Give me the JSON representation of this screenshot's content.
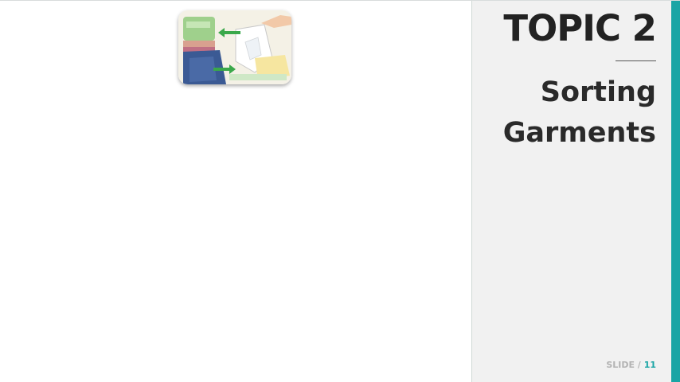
{
  "thumbnail": {
    "image_name": "sorting-garments-illustration"
  },
  "panel": {
    "title": "TOPIC 2",
    "subtitle_lines": [
      "Sorting",
      "Garments"
    ]
  },
  "footer": {
    "slide_label": "SLIDE /",
    "slide_number": "11"
  },
  "colors": {
    "accent": "#1aa5a5",
    "panel_bg": "#f1f1f1",
    "title_text": "#222222",
    "footer_label": "#b3b3b3"
  }
}
